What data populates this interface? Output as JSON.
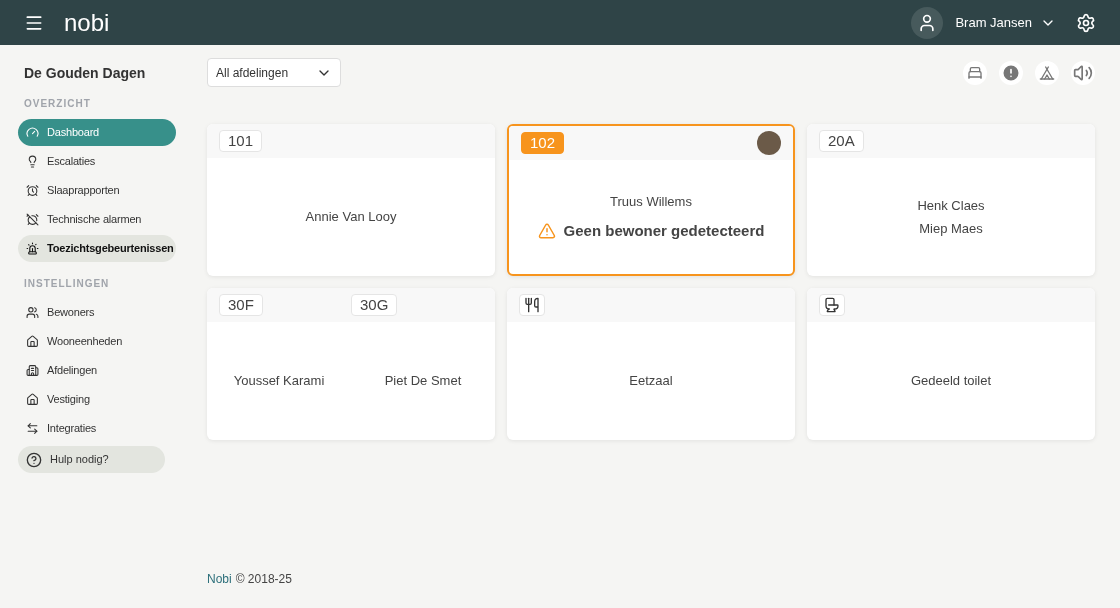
{
  "header": {
    "logo": "nobi",
    "user": "Bram Jansen"
  },
  "sidebar": {
    "facility": "De Gouden Dagen",
    "sections": [
      {
        "title": "OVERZICHT",
        "items": [
          {
            "label": "Dashboard",
            "selected": true,
            "hovered": false
          },
          {
            "label": "Escalaties",
            "selected": false,
            "hovered": false
          },
          {
            "label": "Slaaprapporten",
            "selected": false,
            "hovered": false
          },
          {
            "label": "Technische alarmen",
            "selected": false,
            "hovered": false
          },
          {
            "label": "Toezichtsgebeurtenissen",
            "selected": false,
            "hovered": true
          }
        ]
      },
      {
        "title": "INSTELLINGEN",
        "items": [
          {
            "label": "Bewoners",
            "selected": false,
            "hovered": false
          },
          {
            "label": "Wooneenheden",
            "selected": false,
            "hovered": false
          },
          {
            "label": "Afdelingen",
            "selected": false,
            "hovered": false
          },
          {
            "label": "Vestiging",
            "selected": false,
            "hovered": false
          },
          {
            "label": "Integraties",
            "selected": false,
            "hovered": false
          }
        ]
      }
    ],
    "help": "Hulp nodig?"
  },
  "filter": {
    "value": "All afdelingen"
  },
  "cards": [
    {
      "kind": "room",
      "alert": false,
      "photo": false,
      "units": [
        {
          "label": "101",
          "residents": [
            "Annie Van Looy"
          ]
        }
      ]
    },
    {
      "kind": "room",
      "alert": true,
      "photo": true,
      "warning": "Geen bewoner gedetecteerd",
      "units": [
        {
          "label": "102",
          "residents": [
            "Truus Willems"
          ]
        }
      ]
    },
    {
      "kind": "room",
      "alert": false,
      "photo": false,
      "units": [
        {
          "label": "20A",
          "residents": [
            "Henk Claes",
            "Miep Maes"
          ]
        }
      ]
    },
    {
      "kind": "room",
      "alert": false,
      "photo": false,
      "units": [
        {
          "label": "30F",
          "residents": [
            "Youssef Karami"
          ]
        },
        {
          "label": "30G",
          "residents": [
            "Piet De Smet"
          ]
        }
      ]
    },
    {
      "kind": "dining",
      "name": "Eetzaal"
    },
    {
      "kind": "toilet",
      "name": "Gedeeld toilet"
    }
  ],
  "footer": {
    "brand": "Nobi",
    "copyright": "© 2018-25"
  }
}
